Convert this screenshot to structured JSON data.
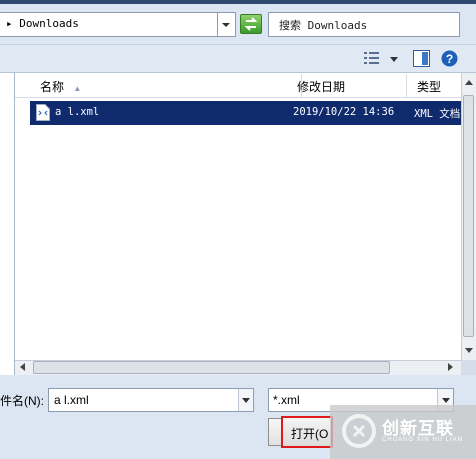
{
  "address_bar": {
    "path": "Downloads"
  },
  "search": {
    "placeholder": "搜索 Downloads"
  },
  "columns": [
    {
      "label": "名称"
    },
    {
      "label": "修改日期"
    },
    {
      "label": "类型"
    }
  ],
  "files": [
    {
      "name": "a  l.xml",
      "modified": "2019/10/22 14:36",
      "type": "XML 文档",
      "selected": true
    }
  ],
  "form": {
    "filename_label": "件名(N):",
    "filename_value": "a  l.xml",
    "filetype_value": "*.xml",
    "open_button": "打开(O"
  },
  "watermark": {
    "text": "创新互联",
    "subtext": "CHUANG XIN HU LIAN"
  },
  "colors": {
    "selection": "#102a6e",
    "highlight_border": "#e01a1a",
    "refresh_green": "#3b9a2a"
  }
}
